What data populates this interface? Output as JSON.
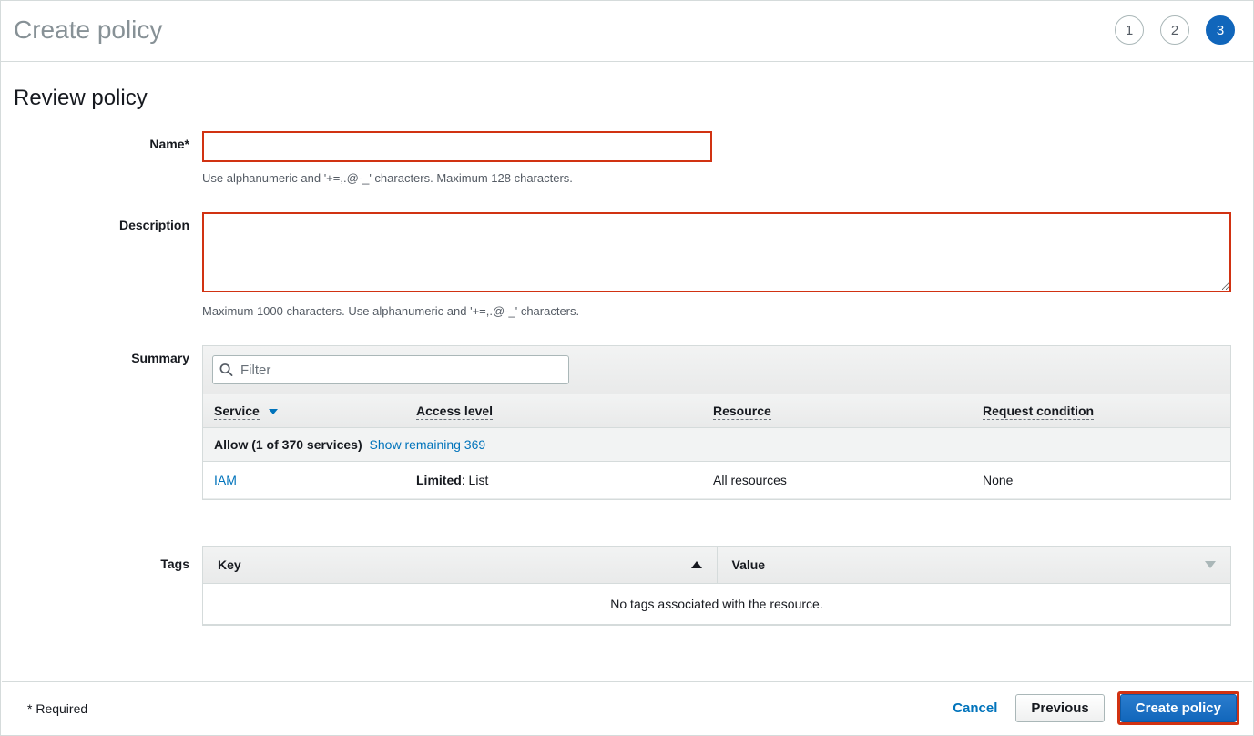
{
  "header": {
    "title": "Create policy",
    "steps": [
      "1",
      "2",
      "3"
    ],
    "active_step_index": 2
  },
  "section": {
    "title": "Review policy"
  },
  "form": {
    "name": {
      "label": "Name*",
      "value": "",
      "help": "Use alphanumeric and '+=,.@-_' characters. Maximum 128 characters."
    },
    "description": {
      "label": "Description",
      "value": "",
      "help": "Maximum 1000 characters. Use alphanumeric and '+=,.@-_' characters."
    }
  },
  "summary": {
    "label": "Summary",
    "filter_placeholder": "Filter",
    "columns": {
      "service": "Service",
      "access": "Access level",
      "resource": "Resource",
      "condition": "Request condition"
    },
    "allow": {
      "text": "Allow (1 of 370 services)",
      "show_link": "Show remaining 369"
    },
    "rows": [
      {
        "service": "IAM",
        "access_bold": "Limited",
        "access_rest": ": List",
        "resource": "All resources",
        "condition": "None"
      }
    ]
  },
  "tags": {
    "label": "Tags",
    "columns": {
      "key": "Key",
      "value": "Value"
    },
    "empty_text": "No tags associated with the resource."
  },
  "footer": {
    "required_note": "* Required",
    "cancel": "Cancel",
    "previous": "Previous",
    "create": "Create policy"
  }
}
